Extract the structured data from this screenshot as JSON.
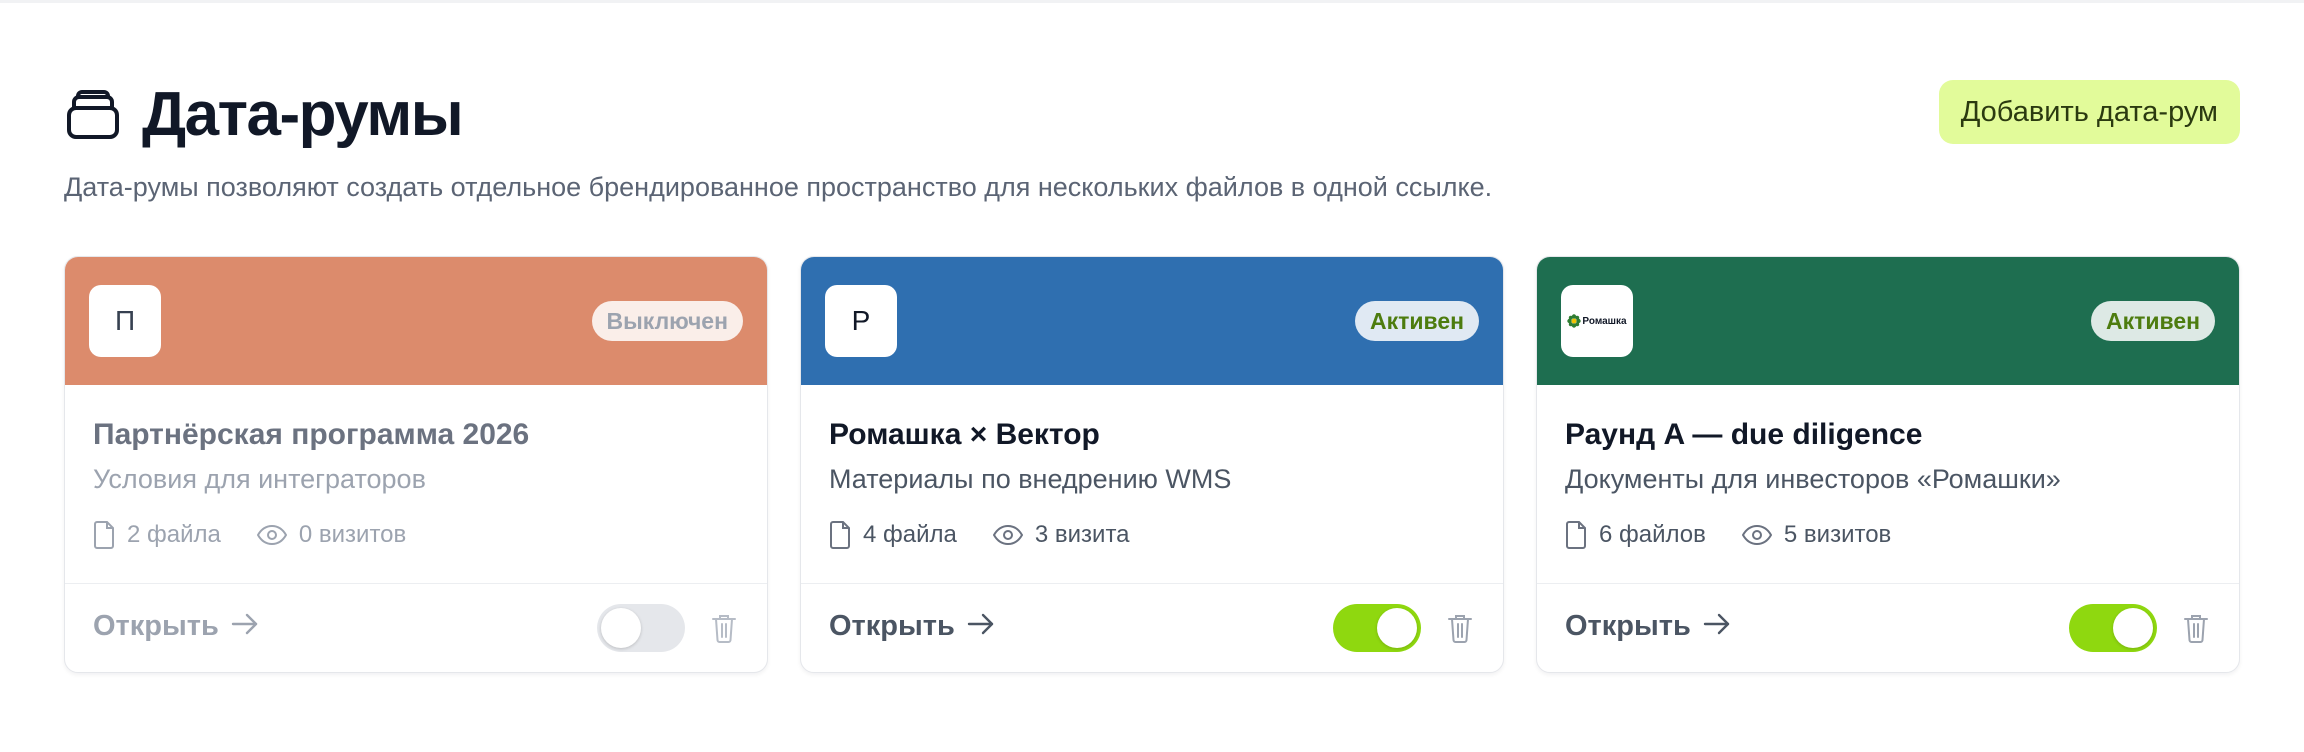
{
  "header": {
    "title": "Дата-румы",
    "title_icon": "stack-folder-icon",
    "add_button_label": "Добавить дата-рум",
    "subtitle": "Дата-румы позволяют создать отдельное брендированное пространство для нескольких файлов в одной ссылке."
  },
  "colors": {
    "accent_button": "#e2fb9a",
    "toggle_on": "#8fd80f",
    "toggle_off": "#e5e7eb"
  },
  "cards": [
    {
      "banner_color": "#dc8b6c",
      "logo_letter": "П",
      "status": "Выключен",
      "status_color": "#9ca3af",
      "title": "Партнёрская программа 2026",
      "description": "Условия для интеграторов",
      "files": "2 файла",
      "visits": "0 визитов",
      "open_label": "Открыть",
      "enabled": false
    },
    {
      "banner_color": "#2f6fb0",
      "logo_letter": "Р",
      "status": "Активен",
      "status_color": "#4d7c0f",
      "title": "Ромашка × Вектор",
      "description": "Материалы по внедрению WMS",
      "files": "4 файла",
      "visits": "3 визита",
      "open_label": "Открыть",
      "enabled": true
    },
    {
      "banner_color": "#1e6e50",
      "logo_text": "Ромашка",
      "status": "Активен",
      "status_color": "#4d7c0f",
      "title": "Раунд A — due diligence",
      "description": "Документы для инвесторов «Ромашки»",
      "files": "6 файлов",
      "visits": "5 визитов",
      "open_label": "Открыть",
      "enabled": true
    }
  ]
}
